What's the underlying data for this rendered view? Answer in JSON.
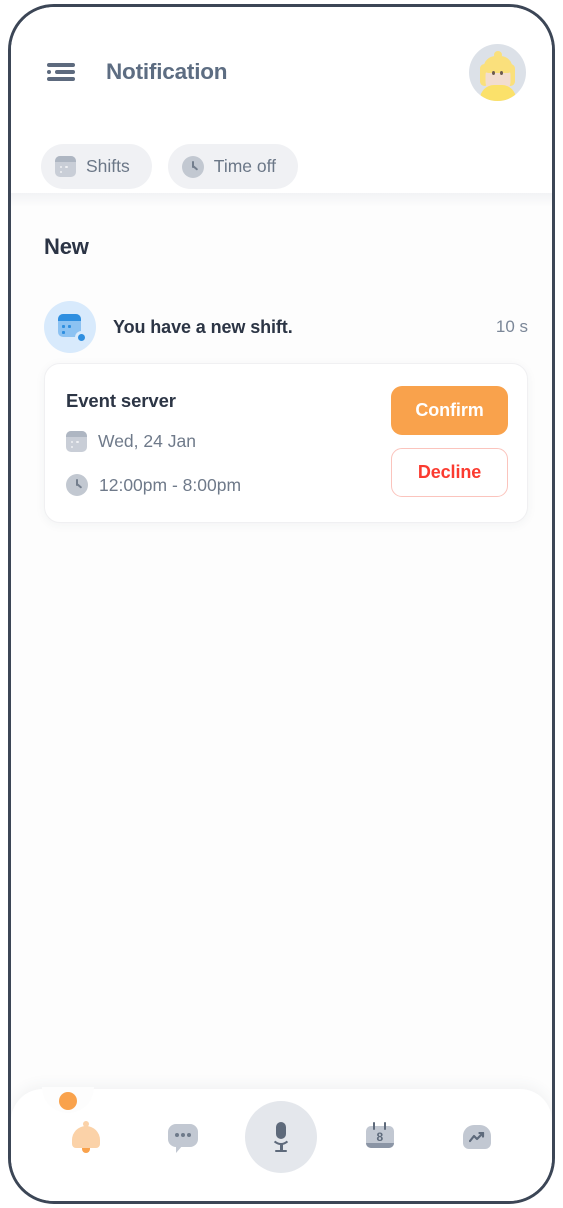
{
  "header": {
    "menu_icon": "hamburger-menu-icon",
    "title": "Notification",
    "avatar_icon": "user-avatar"
  },
  "tabs": [
    {
      "label": "Shifts",
      "icon": "calendar-icon",
      "active": false
    },
    {
      "label": "Time off",
      "icon": "clock-icon",
      "active": false
    }
  ],
  "main": {
    "section_title": "New",
    "notification": {
      "icon": "calendar-settings-icon",
      "message": "You have a new shift.",
      "time": "10 s"
    },
    "event_card": {
      "title": "Event server",
      "date_icon": "calendar-icon",
      "date": "Wed, 24 Jan",
      "time_icon": "clock-icon",
      "time": "12:00pm - 8:00pm",
      "confirm_label": "Confirm",
      "decline_label": "Decline"
    }
  },
  "bottom_nav": {
    "items": [
      {
        "icon": "bell-icon",
        "name": "notifications",
        "active": true
      },
      {
        "icon": "chat-icon",
        "name": "messages",
        "active": false
      },
      {
        "icon": "mic-icon",
        "name": "voice",
        "active": false
      },
      {
        "icon": "calendar-icon",
        "name": "schedule",
        "active": false,
        "day": "8"
      },
      {
        "icon": "chart-icon",
        "name": "insights",
        "active": false
      }
    ]
  },
  "colors": {
    "accent_orange": "#f9a24c",
    "decline_red": "#fb3b30",
    "title_slate": "#5d6d82",
    "text_dark": "#2c3545",
    "text_muted": "#6f7a8a",
    "pill_bg": "#f0f1f4",
    "badge_blue": "#2f8fe0"
  }
}
